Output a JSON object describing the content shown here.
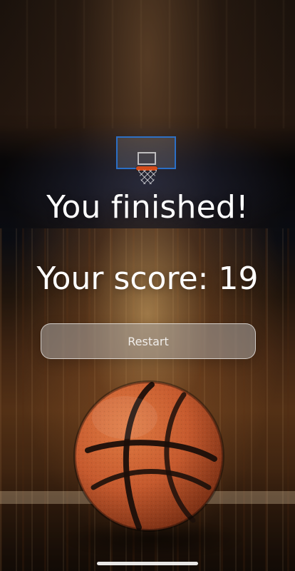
{
  "screen": {
    "title": "You finished!",
    "score_text": "Your score: 19",
    "restart_label": "Restart"
  },
  "scene": {
    "background": "basketball-court-scene",
    "hoop_icon": "basketball-hoop-icon",
    "ball_icon": "basketball-icon"
  },
  "colors": {
    "text": "#ffffff",
    "button_bg": "#aaaaaa",
    "button_border": "#ffffff",
    "ball_orange": "#c65a2e",
    "ball_seams": "#1b0f0a",
    "rim_orange": "#d34b1a"
  }
}
